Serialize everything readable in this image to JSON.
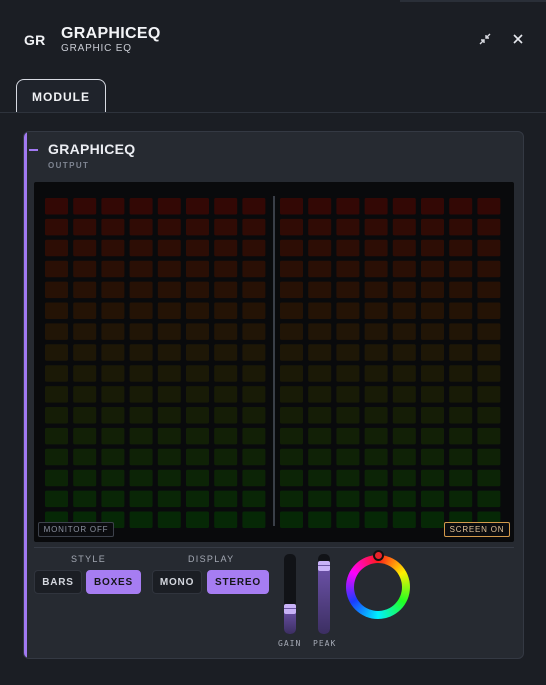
{
  "app": {
    "badge": "GR",
    "title": "GRAPHICEQ",
    "subtitle": "GRAPHIC EQ",
    "collapse_icon": "collapse-arrows-icon",
    "close_icon": "close-icon"
  },
  "tabs": [
    {
      "label": "MODULE",
      "active": true
    }
  ],
  "module": {
    "title": "GRAPHICEQ",
    "subtitle": "OUTPUT",
    "accent_color": "#a179f2"
  },
  "visualizer": {
    "channels": 2,
    "bands_per_channel": 8,
    "rows": 16,
    "lit_boxes": 0,
    "gradient_top": "#ff2a1a",
    "gradient_bottom": "#1ec81e",
    "monitor_chip": "MONITOR OFF",
    "screen_chip": "SCREEN ON",
    "screen_chip_color": "#d39a4c"
  },
  "controls": {
    "style": {
      "label": "STYLE",
      "options": [
        "BARS",
        "BOXES"
      ],
      "selected": "BOXES"
    },
    "display": {
      "label": "DISPLAY",
      "options": [
        "MONO",
        "STEREO"
      ],
      "selected": "STEREO"
    },
    "gain": {
      "label": "GAIN",
      "level": 0.31
    },
    "peak": {
      "label": "PEAK",
      "level": 0.85
    },
    "color": {
      "hue_icon": "color-wheel-icon",
      "selected_color": "#e8242a"
    }
  }
}
